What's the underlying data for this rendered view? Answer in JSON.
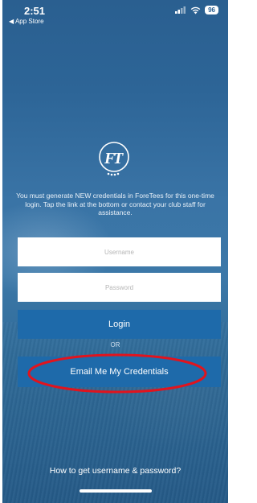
{
  "status_bar": {
    "time": "2:51",
    "back_label": "App Store",
    "battery": "96"
  },
  "login": {
    "notice": "You must generate NEW credentials in ForeTees for this one-time login. Tap the link at the bottom or contact your club staff for assistance.",
    "username_placeholder": "Username",
    "password_placeholder": "Password",
    "login_label": "Login",
    "or_label": "OR",
    "email_label": "Email Me My Credentials",
    "help_link": "How to get username & password?"
  },
  "colors": {
    "background": "#2d6597",
    "button": "#1e6aaa",
    "highlight": "#e0141e"
  },
  "icons": [
    "back-arrow-icon",
    "signal-icon",
    "wifi-icon",
    "battery-icon",
    "foretees-logo"
  ]
}
